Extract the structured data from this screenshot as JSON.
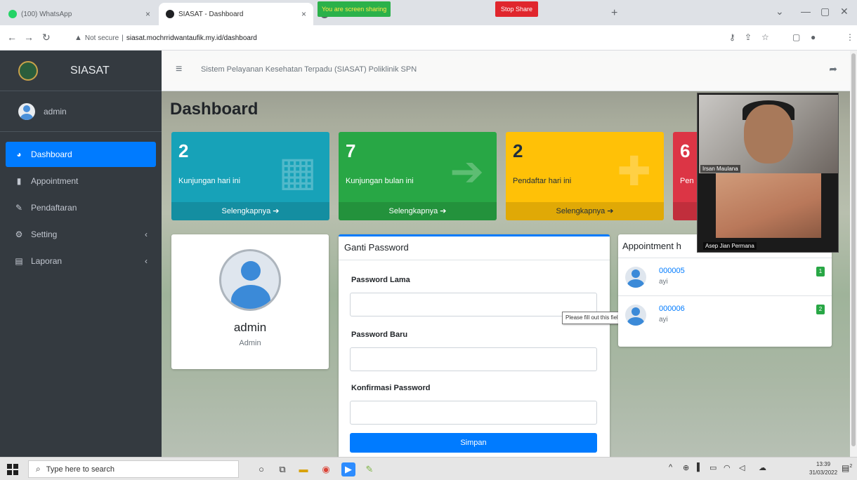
{
  "browser": {
    "tabs": [
      {
        "title": "(100) WhatsApp",
        "favicon_color": "#25d366"
      },
      {
        "title": "SIASAT - Dashboard",
        "favicon_color": "#202124"
      },
      {
        "title": "M",
        "favicon_color": "#5f6368"
      }
    ],
    "screen_share": {
      "banner": "You are screen sharing",
      "stop_label": "Stop Share"
    },
    "url": {
      "security": "Not secure",
      "separator": "|",
      "address": "siasat.mochrridwantaufik.my.id/dashboard"
    }
  },
  "sidebar": {
    "brand": "SIASAT",
    "user": "admin",
    "menu": [
      {
        "label": "Dashboard",
        "icon": "dashboard-icon",
        "glyph": "◕",
        "active": true,
        "has_arrow": false
      },
      {
        "label": "Appointment",
        "icon": "file-icon",
        "glyph": "▮",
        "active": false,
        "has_arrow": false
      },
      {
        "label": "Pendaftaran",
        "icon": "edit-icon",
        "glyph": "✎",
        "active": false,
        "has_arrow": false
      },
      {
        "label": "Setting",
        "icon": "cogs-icon",
        "glyph": "⚙",
        "active": false,
        "has_arrow": true
      },
      {
        "label": "Laporan",
        "icon": "report-icon",
        "glyph": "▤",
        "active": false,
        "has_arrow": true
      }
    ],
    "arrow_glyph": "‹"
  },
  "header": {
    "title": "Sistem Pelayanan Kesehatan Terpadu (SIASAT) Poliklinik SPN"
  },
  "page_title": "Dashboard",
  "stats": [
    {
      "value": "2",
      "label": "Kunjungan hari ini",
      "link": "Selengkapnya",
      "icon": "hospital-icon",
      "glyph": "▦",
      "color": "#17a2b8"
    },
    {
      "value": "7",
      "label": "Kunjungan bulan ini",
      "link": "Selengkapnya",
      "icon": "sign-in-icon",
      "glyph": "➔",
      "color": "#28a745"
    },
    {
      "value": "2",
      "label": "Pendaftar hari ini",
      "link": "Selengkapnya",
      "icon": "user-plus-icon",
      "glyph": "✚",
      "color": "#ffc107"
    },
    {
      "value": "6",
      "label": "Pen",
      "link": "",
      "icon": "",
      "glyph": "",
      "color": "#dc3545"
    }
  ],
  "profile": {
    "name": "admin",
    "role": "Admin"
  },
  "change_password": {
    "title": "Ganti Password",
    "fields": [
      {
        "label": "Password Lama",
        "value": ""
      },
      {
        "label": "Password Baru",
        "value": ""
      },
      {
        "label": "Konfirmasi Password",
        "value": ""
      }
    ],
    "submit": "Simpan",
    "validation_tooltip": "Please fill out this field."
  },
  "appointments": {
    "title": "Appointment h",
    "items": [
      {
        "code": "000005",
        "name": "ayi",
        "badge": "1"
      },
      {
        "code": "000006",
        "name": "ayi",
        "badge": "2"
      }
    ]
  },
  "video_call": {
    "participants": [
      "Irsan Maulana",
      "Asep Jian Permana"
    ]
  },
  "taskbar": {
    "search_placeholder": "Type here to search",
    "time": "13:39",
    "date": "31/03/2022",
    "notification_count": "2"
  }
}
